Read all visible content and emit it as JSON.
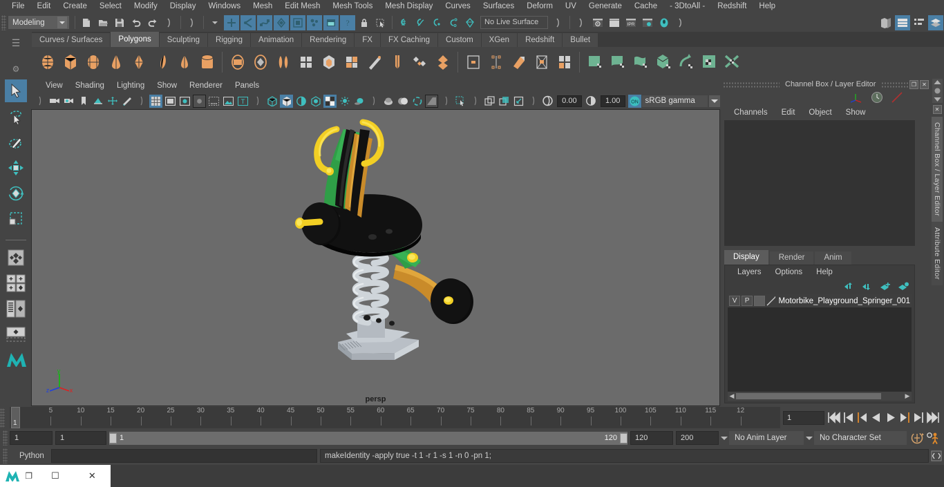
{
  "menubar": {
    "items": [
      "File",
      "Edit",
      "Create",
      "Select",
      "Modify",
      "Display",
      "Windows",
      "Mesh",
      "Edit Mesh",
      "Mesh Tools",
      "Mesh Display",
      "Curves",
      "Surfaces",
      "Deform",
      "UV",
      "Generate",
      "Cache",
      "- 3DtoAll -",
      "Redshift",
      "Help"
    ]
  },
  "statusline": {
    "menu_set": "Modeling",
    "live_surface": "No Live Surface"
  },
  "shelf": {
    "tabs": [
      "Curves / Surfaces",
      "Polygons",
      "Sculpting",
      "Rigging",
      "Animation",
      "Rendering",
      "FX",
      "FX Caching",
      "Custom",
      "XGen",
      "Redshift",
      "Bullet"
    ],
    "active_tab": "Polygons"
  },
  "viewport": {
    "menus": [
      "View",
      "Shading",
      "Lighting",
      "Show",
      "Renderer",
      "Panels"
    ],
    "exposure": "0.00",
    "gamma": "1.00",
    "color_space": "sRGB gamma",
    "camera_label": "persp",
    "axis": {
      "x": "x",
      "y": "y",
      "z": "z"
    }
  },
  "channel_box": {
    "title": "Channel Box / Layer Editor",
    "menus": [
      "Channels",
      "Edit",
      "Object",
      "Show"
    ]
  },
  "layer_editor": {
    "tabs": [
      "Display",
      "Render",
      "Anim"
    ],
    "active_tab": "Display",
    "menus": [
      "Layers",
      "Options",
      "Help"
    ],
    "layers": [
      {
        "visibility": "V",
        "playback": "P",
        "color": "",
        "name": "Motorbike_Playground_Springer_001"
      }
    ]
  },
  "dock": {
    "tabs": [
      "Channel Box / Layer Editor",
      "Attribute Editor"
    ],
    "active": "Channel Box / Layer Editor"
  },
  "timeline": {
    "current_frame": "1",
    "frame_field": "1",
    "tick_labels": [
      "5",
      "10",
      "15",
      "20",
      "25",
      "30",
      "35",
      "40",
      "45",
      "50",
      "55",
      "60",
      "65",
      "70",
      "75",
      "80",
      "85",
      "90",
      "95",
      "100",
      "105",
      "110",
      "115",
      "12"
    ]
  },
  "range": {
    "anim_start": "1",
    "range_start": "1",
    "range_bar_start": "1",
    "range_bar_end": "120",
    "range_end": "120",
    "anim_end": "200",
    "anim_layer": "No Anim Layer",
    "character_set": "No Character Set"
  },
  "command_line": {
    "language": "Python",
    "input_value": "",
    "output": "makeIdentity -apply true -t 1 -r 1 -s 1 -n 0 -pn 1;"
  },
  "taskbar": {
    "restore": "❐",
    "minimize": "☐",
    "close": "✕"
  },
  "colors": {
    "accent_blue": "#4a7fa5",
    "shelf_orange": "#e8a063",
    "shelf_green": "#6eb392",
    "teal": "#3fbfbf",
    "panel_bg": "#444444",
    "viewport_bg": "#6b6b6b"
  }
}
